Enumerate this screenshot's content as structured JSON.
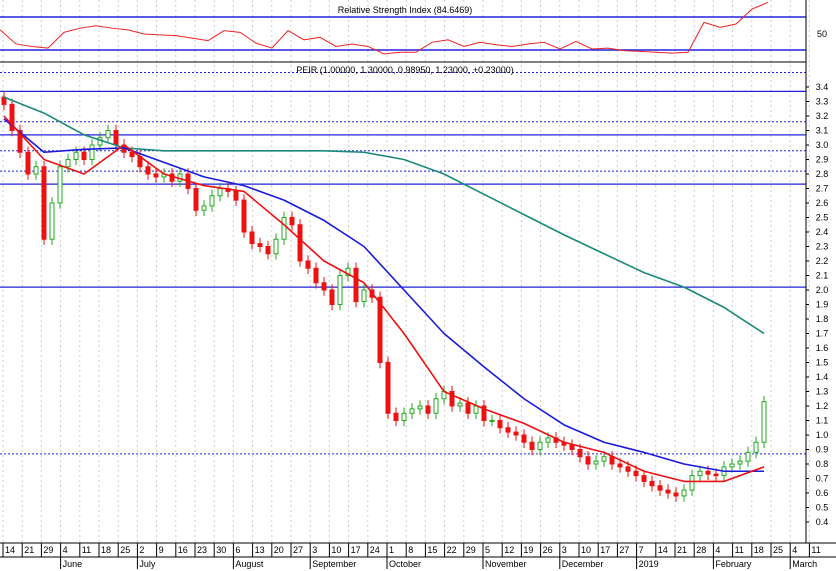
{
  "colors": {
    "up": "#22aa22",
    "down": "#ee1111",
    "ma_short": "#ee1111",
    "ma_mid": "#1a1adc",
    "ma_long": "#1a8a7a",
    "hline": "#2222dd",
    "rsi": "#ee2222"
  },
  "rsi": {
    "title": "Relative Strength Index (84.6469)",
    "axis_label": "50",
    "upper": 70,
    "lower": 30,
    "values": [
      55,
      38,
      35,
      33,
      52,
      57,
      60,
      57,
      55,
      50,
      49,
      48,
      45,
      42,
      54,
      52,
      39,
      33,
      54,
      43,
      46,
      35,
      38,
      35,
      26,
      28,
      28,
      40,
      43,
      35,
      40,
      37,
      35,
      38,
      40,
      32,
      41,
      32,
      33,
      30,
      29,
      28,
      27,
      28,
      64,
      58,
      62,
      80,
      88
    ]
  },
  "chart_data": {
    "type": "candlestick",
    "title": "PEIR (1.00000, 1.30000, 0.98950, 1.23000, +0.23000)",
    "ylim": [
      0.35,
      3.45
    ],
    "yticks": [
      "3.4",
      "3.3",
      "3.2",
      "3.1",
      "3.0",
      "2.9",
      "2.8",
      "2.7",
      "2.6",
      "2.5",
      "2.4",
      "2.3",
      "2.2",
      "2.1",
      "2.0",
      "1.9",
      "1.8",
      "1.7",
      "1.6",
      "1.5",
      "1.4",
      "1.3",
      "1.2",
      "1.1",
      "1.0",
      "0.9",
      "0.8",
      "0.7",
      "0.6",
      "0.5",
      "0.4"
    ],
    "close": [
      3.28,
      3.1,
      2.95,
      2.8,
      2.85,
      2.35,
      2.6,
      2.85,
      2.9,
      2.95,
      2.9,
      3.0,
      3.05,
      3.1,
      3.0,
      2.95,
      2.92,
      2.85,
      2.8,
      2.78,
      2.8,
      2.75,
      2.8,
      2.7,
      2.55,
      2.58,
      2.65,
      2.7,
      2.68,
      2.62,
      2.4,
      2.32,
      2.3,
      2.25,
      2.35,
      2.5,
      2.45,
      2.2,
      2.15,
      2.05,
      2.0,
      1.9,
      2.1,
      2.15,
      1.92,
      2.0,
      1.95,
      1.5,
      1.15,
      1.1,
      1.15,
      1.18,
      1.2,
      1.15,
      1.25,
      1.3,
      1.2,
      1.22,
      1.15,
      1.2,
      1.1,
      1.1,
      1.05,
      1.02,
      1.0,
      0.95,
      0.9,
      0.95,
      0.98,
      0.95,
      0.93,
      0.9,
      0.85,
      0.8,
      0.82,
      0.85,
      0.8,
      0.78,
      0.75,
      0.72,
      0.68,
      0.65,
      0.62,
      0.6,
      0.58,
      0.62,
      0.72,
      0.75,
      0.73,
      0.72,
      0.78,
      0.8,
      0.82,
      0.88,
      0.95,
      1.23
    ],
    "ma_short": [
      3.2,
      2.9,
      2.8,
      3.0,
      2.8,
      2.72,
      2.68,
      2.45,
      2.2,
      2.05,
      1.7,
      1.3,
      1.18,
      1.08,
      0.95,
      0.88,
      0.75,
      0.68,
      0.68,
      0.78
    ],
    "ma_mid": [
      3.18,
      2.95,
      2.97,
      2.98,
      2.88,
      2.78,
      2.72,
      2.62,
      2.48,
      2.3,
      2.0,
      1.7,
      1.47,
      1.25,
      1.07,
      0.95,
      0.88,
      0.8,
      0.75,
      0.75
    ],
    "ma_long": [
      3.33,
      3.22,
      3.07,
      2.98,
      2.96,
      2.96,
      2.96,
      2.96,
      2.96,
      2.95,
      2.9,
      2.8,
      2.66,
      2.52,
      2.38,
      2.25,
      2.12,
      2.02,
      1.88,
      1.7
    ],
    "solid_levels": [
      3.37,
      3.07,
      2.73,
      2.02
    ],
    "dotted_levels": [
      3.5,
      3.16,
      2.96,
      2.82,
      0.87
    ],
    "xticks": [
      "14",
      "21",
      "29",
      "4",
      "11",
      "18",
      "25",
      "2",
      "9",
      "16",
      "23",
      "30",
      "6",
      "13",
      "20",
      "27",
      "3",
      "10",
      "17",
      "24",
      "1",
      "8",
      "15",
      "22",
      "29",
      "5",
      "12",
      "19",
      "26",
      "3",
      "10",
      "17",
      "27",
      "7",
      "14",
      "21",
      "28",
      "4",
      "11",
      "18",
      "25",
      "4",
      "11"
    ],
    "months": [
      {
        "at": 3,
        "label": "June"
      },
      {
        "at": 7,
        "label": "July"
      },
      {
        "at": 12,
        "label": "August"
      },
      {
        "at": 16,
        "label": "September"
      },
      {
        "at": 20,
        "label": "October"
      },
      {
        "at": 25,
        "label": "November"
      },
      {
        "at": 29,
        "label": "December"
      },
      {
        "at": 33,
        "label": "2019"
      },
      {
        "at": 37,
        "label": "February"
      },
      {
        "at": 41,
        "label": "March"
      }
    ]
  }
}
